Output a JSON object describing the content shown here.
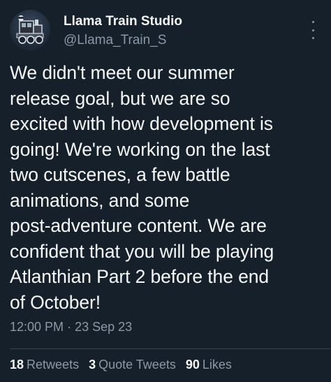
{
  "author": {
    "name": "Llama Train Studio",
    "handle": "@Llama_Train_S"
  },
  "tweet": {
    "lines": [
      "We didn't meet our summer",
      "release goal, but we are so",
      "excited with how development is",
      "going! We're working on the last",
      "two cutscenes, a few battle",
      "animations, and some",
      "post-adventure content. We are",
      "confident that you will be playing",
      "Atlanthian Part 2 before the end",
      "of October!"
    ],
    "time": "12:00 PM",
    "separator": "·",
    "date": "23 Sep 23"
  },
  "stats": {
    "retweets": {
      "count": "18",
      "label": "Retweets"
    },
    "quotes": {
      "count": "3",
      "label": "Quote Tweets"
    },
    "likes": {
      "count": "90",
      "label": "Likes"
    }
  },
  "icons": {
    "more": "more-options-icon"
  },
  "colors": {
    "background": "#15202b",
    "text": "#f7f9f9",
    "secondary": "#8b98a5",
    "divider": "#38444d"
  }
}
